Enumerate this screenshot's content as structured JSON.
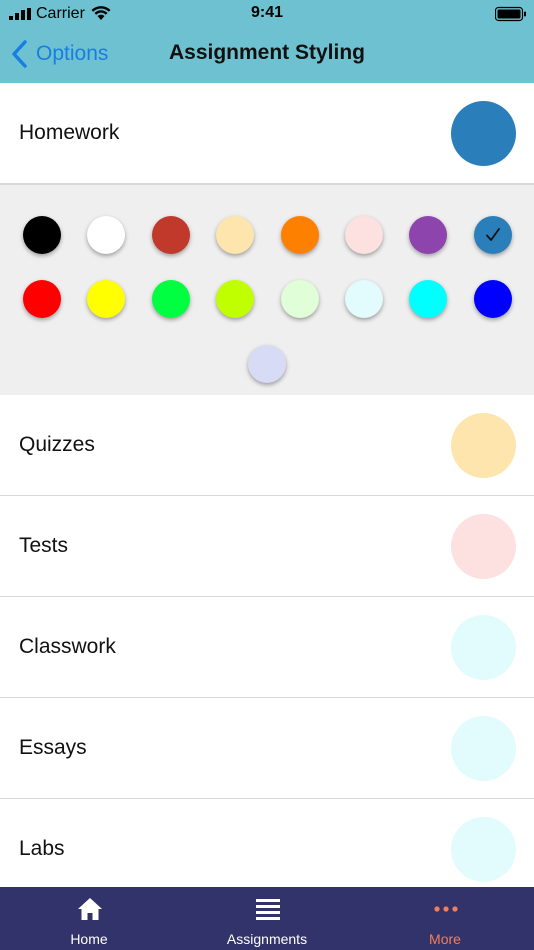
{
  "status_bar": {
    "carrier": "Carrier",
    "time": "9:41"
  },
  "nav": {
    "back_label": "Options",
    "title": "Assignment Styling"
  },
  "colors": {
    "header_bg": "#6dc1d1",
    "link": "#1a7ee0",
    "tabbar_bg": "#33336b",
    "tab_active": "#f07f5a"
  },
  "assignment_types": [
    {
      "label": "Homework",
      "color": "#2a7fba"
    },
    {
      "label": "Quizzes",
      "color": "#fde5ad"
    },
    {
      "label": "Tests",
      "color": "#fde0e0"
    },
    {
      "label": "Classwork",
      "color": "#e2fbfd"
    },
    {
      "label": "Essays",
      "color": "#e2fbfd"
    },
    {
      "label": "Labs",
      "color": "#e2fbfd"
    }
  ],
  "palette": {
    "selected_index": 7,
    "swatches": [
      "#000000",
      "#ffffff",
      "#c0392b",
      "#fde5ad",
      "#fe8000",
      "#fde0e0",
      "#8e44ad",
      "#2a7fba",
      "#fe0000",
      "#ffff00",
      "#00ff40",
      "#bfff00",
      "#e0ffd8",
      "#e2fbfd",
      "#00ffff",
      "#0000ff",
      "#d8dbf6"
    ]
  },
  "tabs": [
    {
      "label": "Home",
      "icon": "home-icon",
      "active": false
    },
    {
      "label": "Assignments",
      "icon": "list-icon",
      "active": false
    },
    {
      "label": "More",
      "icon": "more-dots-icon",
      "active": true
    }
  ]
}
